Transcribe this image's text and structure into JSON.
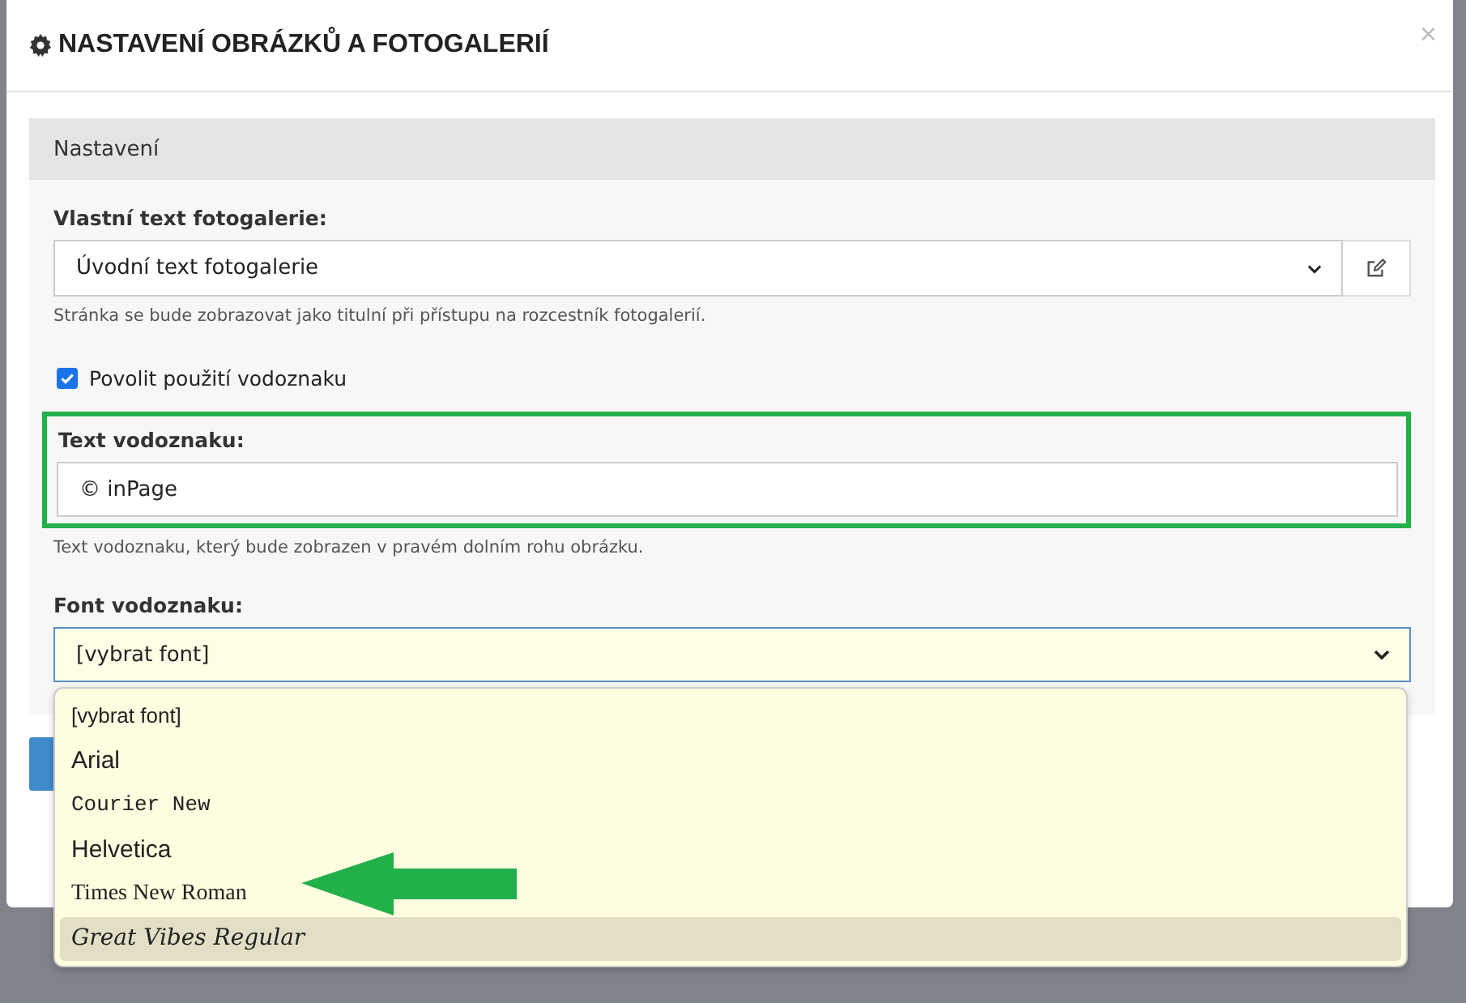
{
  "dialog": {
    "title": "NASTAVENÍ OBRÁZKŮ A FOTOGALERIÍ",
    "close": "×"
  },
  "panel": {
    "heading": "Nastavení",
    "gallery_text": {
      "label": "Vlastní text fotogalerie:",
      "value": "Úvodní text fotogalerie",
      "help": "Stránka se bude zobrazovat jako titulní při přístupu na rozcestník fotogalerií."
    },
    "watermark_enabled": {
      "label": "Povolit použití vodoznaku",
      "checked": true
    },
    "watermark_text": {
      "label": "Text vodoznaku:",
      "value": "© inPage",
      "help": "Text vodoznaku, který bude zobrazen v pravém dolním rohu obrázku.",
      "highlighted": true
    },
    "watermark_font": {
      "label": "Font vodoznaku:",
      "value": "[vybrat font]",
      "options": [
        {
          "label": "[vybrat font]",
          "kind": "default",
          "highlighted": false
        },
        {
          "label": "Arial",
          "kind": "sans",
          "highlighted": false
        },
        {
          "label": "Courier New",
          "kind": "mono",
          "highlighted": false
        },
        {
          "label": "Helvetica",
          "kind": "sans",
          "highlighted": false
        },
        {
          "label": "Times New Roman",
          "kind": "serif",
          "highlighted": false
        },
        {
          "label": "Great Vibes Regular",
          "kind": "script",
          "highlighted": true
        }
      ]
    }
  }
}
